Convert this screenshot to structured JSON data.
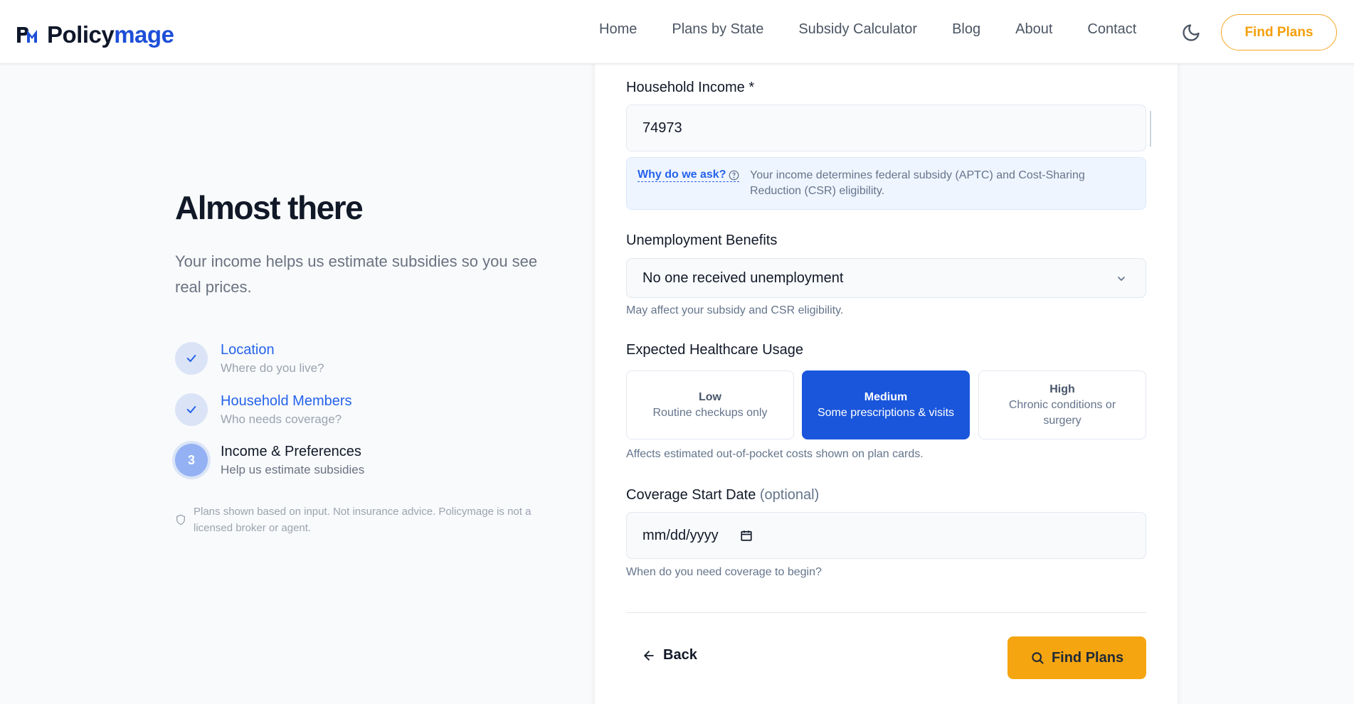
{
  "brand": {
    "name_part1": "Policy",
    "name_part2": "mage"
  },
  "nav": {
    "items": [
      "Home",
      "Plans by State",
      "Subsidy Calculator",
      "Blog",
      "About",
      "Contact"
    ],
    "theme_icon": "moon-icon",
    "cta": "Find Plans"
  },
  "left": {
    "title": "Almost there",
    "subtitle": "Your income helps us estimate subsidies so you see real prices.",
    "steps": [
      {
        "title": "Location",
        "desc": "Where do you live?",
        "status": "done"
      },
      {
        "title": "Household Members",
        "desc": "Who needs coverage?",
        "status": "done"
      },
      {
        "number": "3",
        "title": "Income & Preferences",
        "desc": "Help us estimate subsidies",
        "status": "current"
      }
    ],
    "disclaimer": "Plans shown based on input. Not insurance advice. Policymage is not a licensed broker or agent."
  },
  "form": {
    "income": {
      "label": "Household Income *",
      "value": "74973",
      "why_link": "Why do we ask?",
      "help": "Your income determines federal subsidy (APTC) and Cost-Sharing Reduction (CSR) eligibility."
    },
    "unemployment": {
      "label": "Unemployment Benefits",
      "selected": "No one received unemployment",
      "hint": "May affect your subsidy and CSR eligibility."
    },
    "usage": {
      "label": "Expected Healthcare Usage",
      "options": [
        {
          "title": "Low",
          "desc": "Routine checkups only"
        },
        {
          "title": "Medium",
          "desc": "Some prescriptions & visits"
        },
        {
          "title": "High",
          "desc": "Chronic conditions or surgery"
        }
      ],
      "selected": "Medium",
      "hint": "Affects estimated out-of-pocket costs shown on plan cards."
    },
    "start_date": {
      "label": "Coverage Start Date",
      "optional": "(optional)",
      "placeholder": "mm/dd/yyyy",
      "hint": "When do you need coverage to begin?"
    },
    "back": "Back",
    "submit": "Find Plans"
  },
  "colors": {
    "primary": "#1a56db",
    "accent": "#f5a510",
    "link": "#2563eb"
  }
}
